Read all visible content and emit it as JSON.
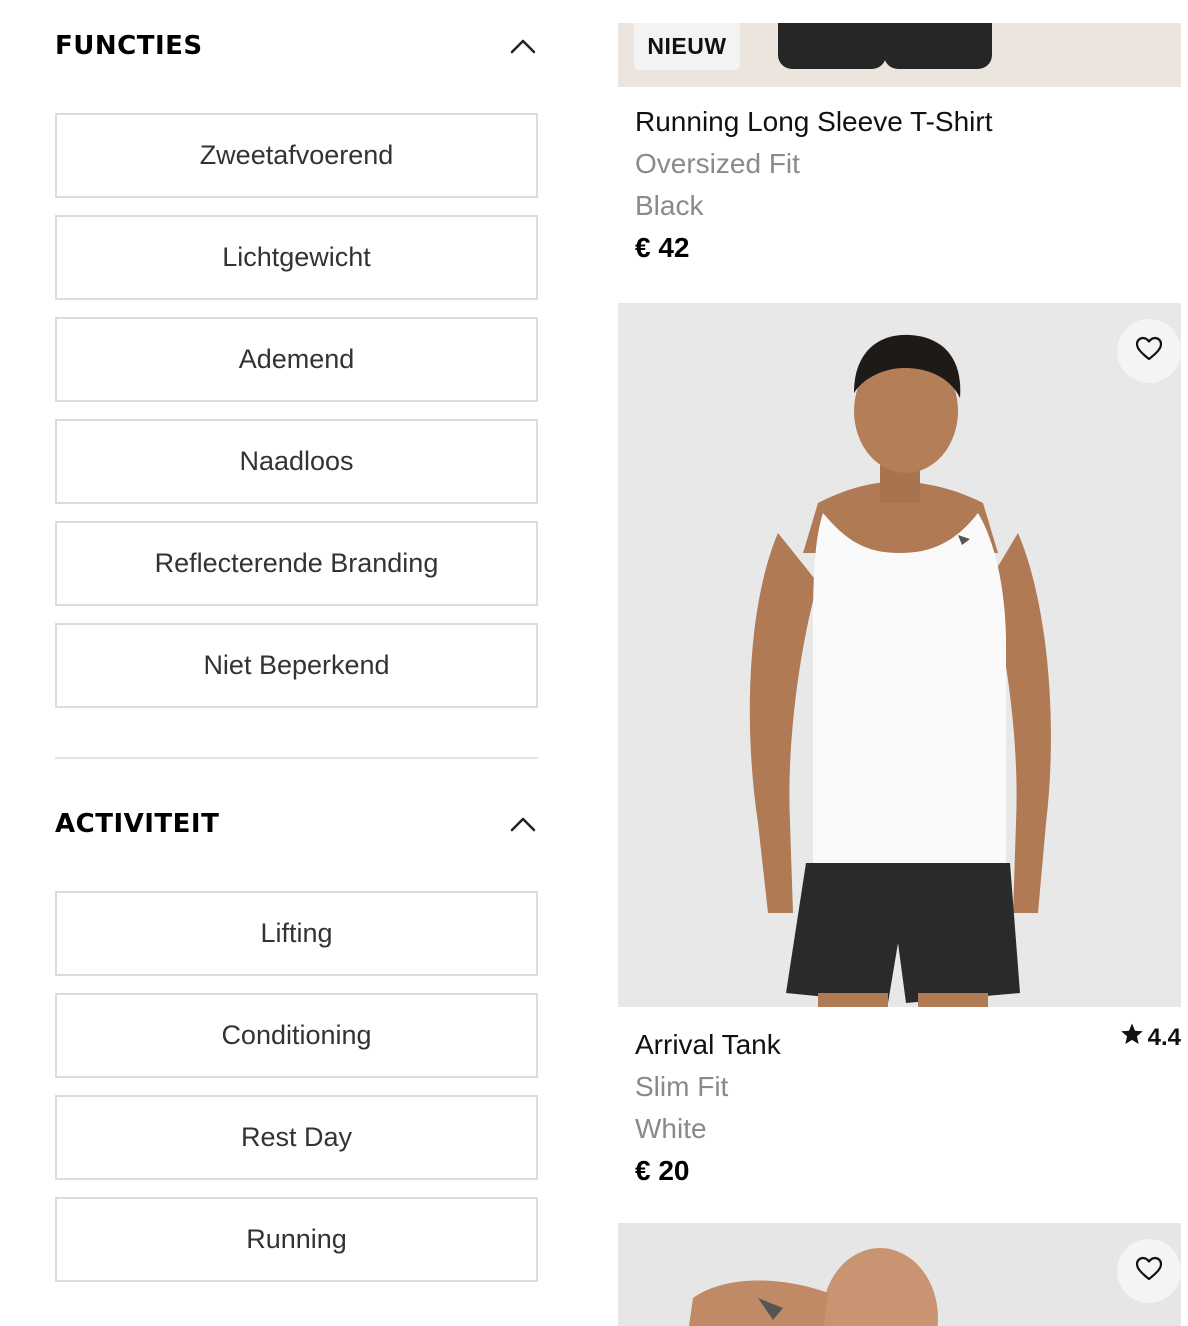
{
  "filters": {
    "functies": {
      "title": "FUNCTIES",
      "options": [
        "Zweetafvoerend",
        "Lichtgewicht",
        "Ademend",
        "Naadloos",
        "Reflecterende Branding",
        "Niet Beperkend"
      ]
    },
    "activiteit": {
      "title": "ACTIVITEIT",
      "options": [
        "Lifting",
        "Conditioning",
        "Rest Day",
        "Running"
      ]
    }
  },
  "products": [
    {
      "badge": "NIEUW",
      "name": "Running Long Sleeve T-Shirt",
      "fit": "Oversized Fit",
      "color": "Black",
      "price": "€ 42"
    },
    {
      "name": "Arrival Tank",
      "fit": "Slim Fit",
      "color": "White",
      "price": "€ 20",
      "rating": "4.4"
    }
  ],
  "icons": {
    "collapse": "chevron-up-icon",
    "wishlist": "heart-icon",
    "rating": "star-icon"
  },
  "colors": {
    "border": "#dcdcdc",
    "muted_text": "#8a8a8a",
    "image_bg": "#e8e8e8"
  }
}
